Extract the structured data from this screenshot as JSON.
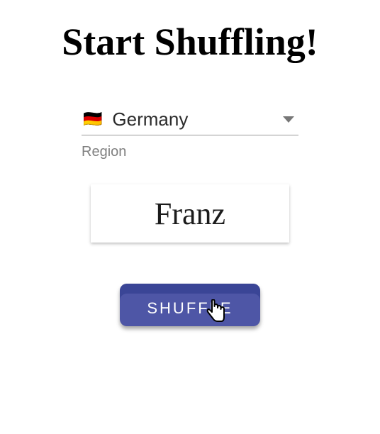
{
  "title": "Start Shuffling!",
  "region_select": {
    "label": "Region",
    "flag_emoji": "🇩🇪",
    "value": "Germany"
  },
  "result_name": "Franz",
  "shuffle_button": {
    "label": "SHUFFLE"
  }
}
